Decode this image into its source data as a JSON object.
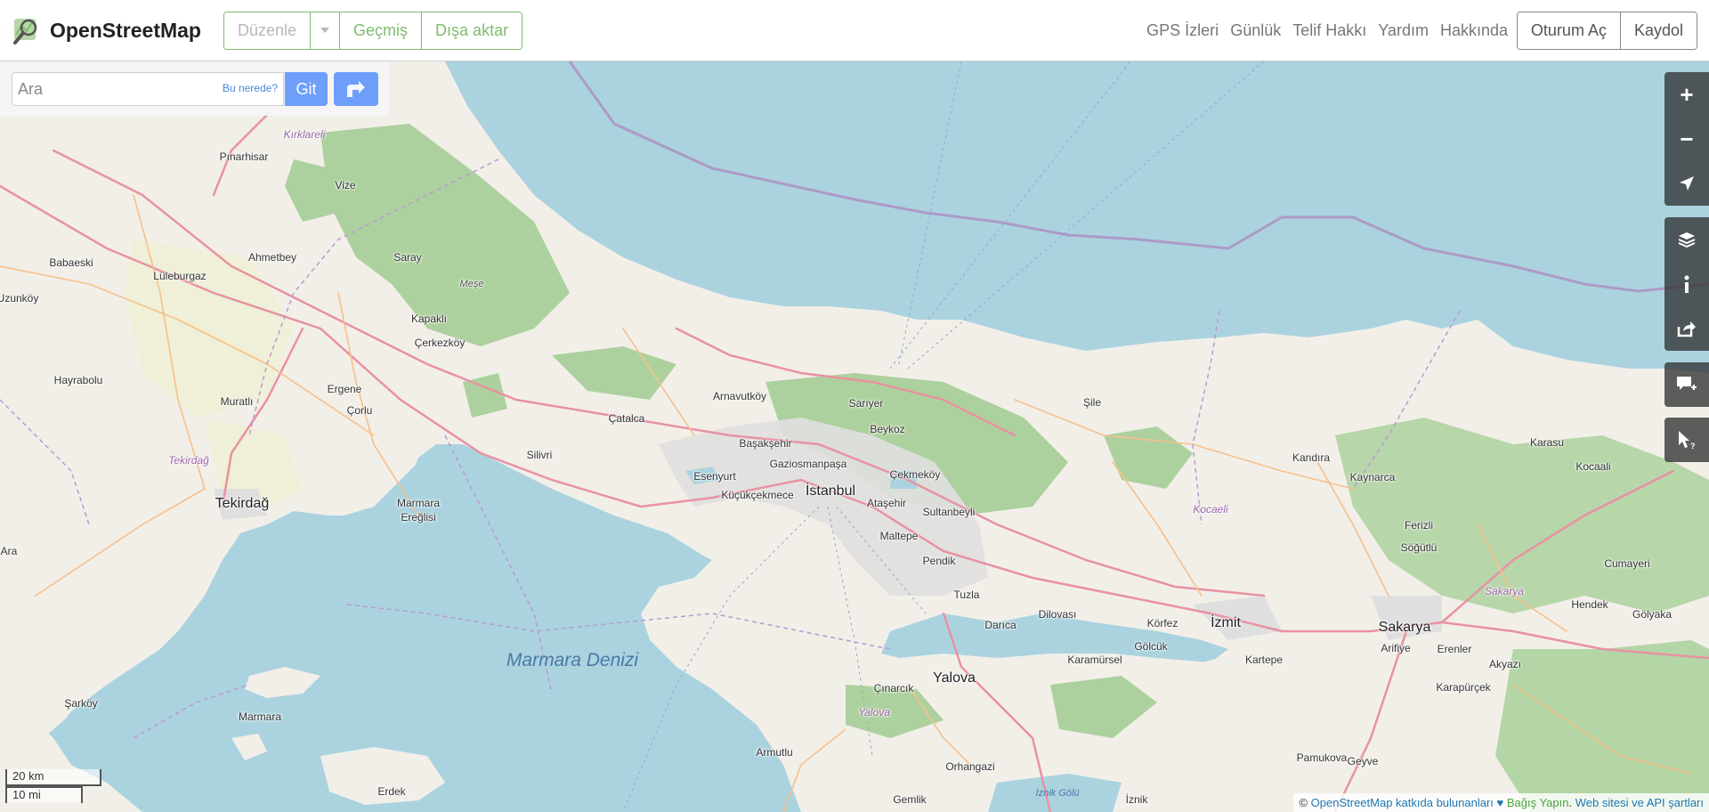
{
  "header": {
    "logo_text": "OpenStreetMap",
    "edit_buttons": [
      {
        "label": "Düzenle",
        "enabled": false
      },
      {
        "label": "Geçmiş",
        "enabled": true
      },
      {
        "label": "Dışa aktar",
        "enabled": true
      }
    ],
    "nav_links": [
      "GPS İzleri",
      "Günlük",
      "Telif Hakkı",
      "Yardım",
      "Hakkında"
    ],
    "login_label": "Oturum Aç",
    "signup_label": "Kaydol"
  },
  "search": {
    "placeholder": "Ara",
    "where_label": "Bu nerede?",
    "go_label": "Git"
  },
  "controls": {
    "zoom_in": "+",
    "zoom_out": "−",
    "icons": [
      "locate-icon",
      "layers-icon",
      "info-icon",
      "share-icon",
      "note-icon",
      "query-icon"
    ]
  },
  "scale": {
    "metric": "20 km",
    "imperial": "10 mi"
  },
  "attribution": {
    "prefix": "© ",
    "osm_link": "OpenStreetMap",
    "contributors": " katkıda bulunanları ♥ ",
    "donate": "Bağış Yapın",
    "sep": ". ",
    "terms": "Web sitesi ve API şartları"
  },
  "colors": {
    "land": "#f2efe9",
    "water": "#aad3df",
    "forest": "#add19e",
    "farmland": "#eef0d5",
    "urban": "#e0dfdf",
    "major_road": "#e892a2",
    "secondary_road": "#f7c08a",
    "boundary": "#ac9ac8",
    "accent": "#7ebc6f",
    "search_button": "#6d9efa"
  },
  "labels": {
    "cities": [
      "Tekirdağ",
      "İstanbul",
      "İzmit",
      "Sakarya",
      "Yalova"
    ],
    "towns": [
      "Kırklareli",
      "Pınarhisar",
      "Vize",
      "Babaeski",
      "Lüleburgaz",
      "Ahmetbey",
      "Saray",
      "Kapaklı",
      "Çerkezköy",
      "Hayrabolu",
      "Muratlı",
      "Ergene",
      "Çorlu",
      "Marmara Ereğlisi",
      "Silivri",
      "Çatalca",
      "Arnavutköy",
      "Sarıyer",
      "Başakşehir",
      "Beykoz",
      "Esenyurt",
      "Gaziosmanpaşa",
      "Çekmeköy",
      "Küçükçekmece",
      "Ataşehir",
      "Sultanbeyli",
      "Maltepe",
      "Pendik",
      "Tuzla",
      "Darıca",
      "Dilovası",
      "Körfez",
      "Gölcük",
      "Karamürsel",
      "Kartepe",
      "Şile",
      "Kandıra",
      "Kaynarca",
      "Karasu",
      "Kocaali",
      "Ferizli",
      "Söğütlü",
      "Cumayeri",
      "Hendek",
      "Gölyaka",
      "Arifiye",
      "Erenler",
      "Akyazı",
      "Karapürçek",
      "Pamukova",
      "Geyve",
      "Çınarcık",
      "Armutlu",
      "Orhangazi",
      "Gemlik",
      "İznik",
      "Şarköy",
      "Marmara",
      "Erdek",
      "Uzunköy",
      "Ara"
    ],
    "regions": [
      "Tekirdağ",
      "Kocaeli",
      "Sakarya",
      "Yalova"
    ],
    "sea": "Marmara Denizi",
    "lake": "İznik Gölü",
    "forest": "Meşe"
  }
}
